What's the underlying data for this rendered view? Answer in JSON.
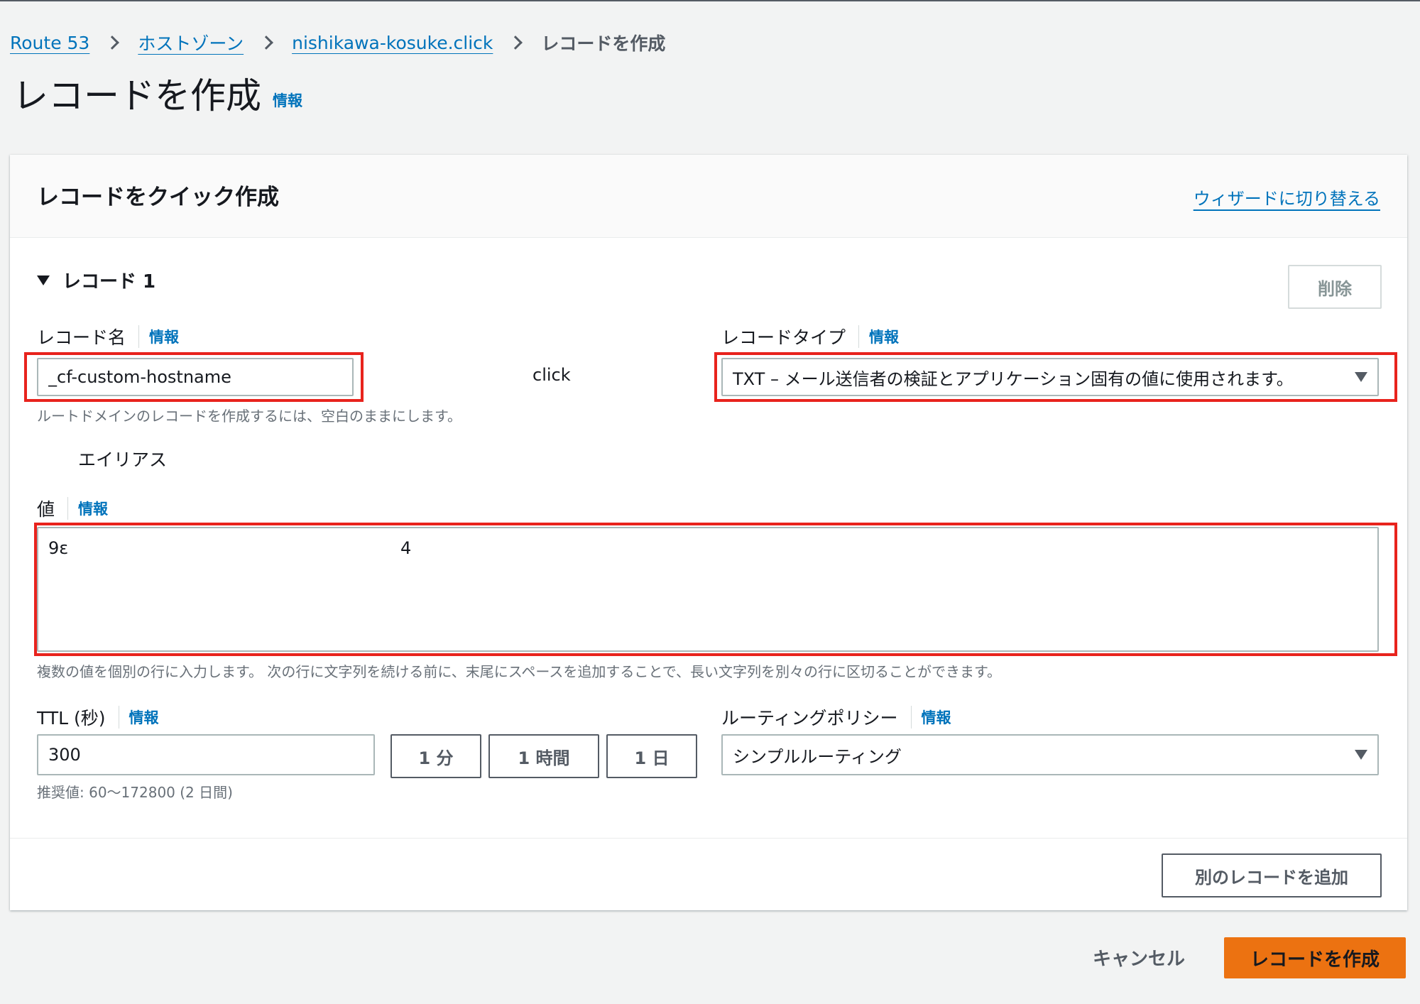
{
  "breadcrumb": {
    "items": [
      "Route 53",
      "ホストゾーン",
      "nishikawa-kosuke.click"
    ],
    "current": "レコードを作成"
  },
  "page": {
    "title": "レコードを作成",
    "info": "情報"
  },
  "container": {
    "title": "レコードをクイック作成",
    "wizard_link": "ウィザードに切り替える"
  },
  "record": {
    "heading": "レコード 1",
    "delete_label": "削除",
    "name": {
      "label": "レコード名",
      "info": "情報",
      "value": "_cf-custom-hostname",
      "suffix": "click",
      "hint": "ルートドメインのレコードを作成するには、空白のままにします。"
    },
    "type": {
      "label": "レコードタイプ",
      "info": "情報",
      "selected": "TXT – メール送信者の検証とアプリケーション固有の値に使用されます。"
    },
    "alias": {
      "label": "エイリアス",
      "enabled": false
    },
    "value": {
      "label": "値",
      "info": "情報",
      "line_start": "9ɛ",
      "line_end": "4",
      "hint": "複数の値を個別の行に入力します。 次の行に文字列を続ける前に、末尾にスペースを追加することで、長い文字列を別々の行に区切ることができます。"
    },
    "ttl": {
      "label": "TTL (秒)",
      "info": "情報",
      "value": "300",
      "presets": [
        "1 分",
        "1 時間",
        "1 日"
      ],
      "hint": "推奨値: 60〜172800 (2 日間)"
    },
    "routing": {
      "label": "ルーティングポリシー",
      "info": "情報",
      "selected": "シンプルルーティング"
    }
  },
  "add_record_label": "別のレコードを追加",
  "footer": {
    "cancel_label": "キャンセル",
    "create_label": "レコードを作成"
  },
  "colors": {
    "link": "#0073bb",
    "primary": "#ec7211",
    "highlight": "#e8231d",
    "background": "#f2f3f3"
  }
}
